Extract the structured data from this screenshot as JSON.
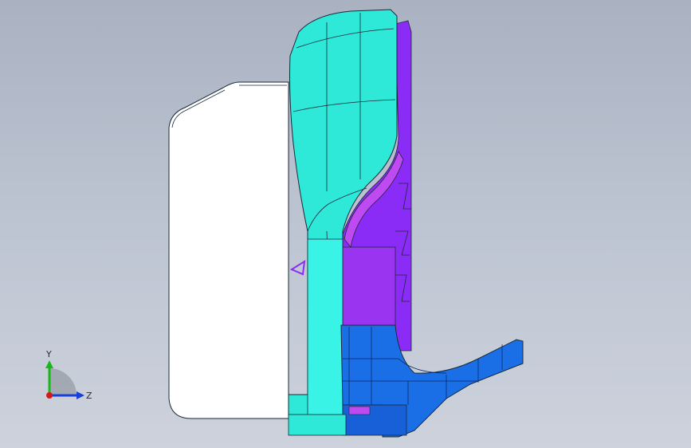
{
  "viewport": {
    "background_top": "#aab2c2",
    "background_bottom": "#cdd2dc"
  },
  "model": {
    "colors": {
      "housing_white": "#ffffff",
      "shell_cyan": "#2ee8d8",
      "shell_cyan_light": "#39f3e6",
      "inner_purple": "#8a2cf5",
      "inner_magenta": "#b23cf0",
      "base_blue": "#1a6fe6",
      "base_blue_dark": "#0d55c8",
      "edge": "#1b2a3a"
    }
  },
  "triad": {
    "x_label": "",
    "y_label": "Y",
    "z_label": "Z",
    "y_color": "#18b818",
    "z_color": "#1a3fd8",
    "origin_color": "#d81818"
  }
}
